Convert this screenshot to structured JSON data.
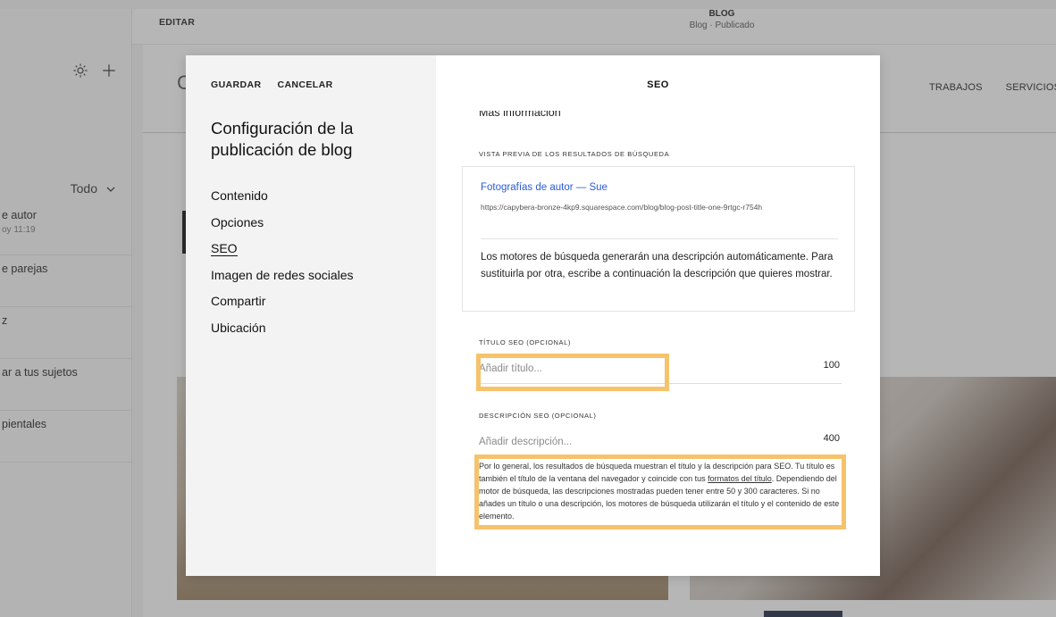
{
  "left_panel": {
    "filter_label": "Todo",
    "items": [
      {
        "title": "e autor",
        "subtitle": "oy 11:19"
      },
      {
        "title": "e parejas",
        "subtitle": ""
      },
      {
        "title": "z",
        "subtitle": ""
      },
      {
        "title": "ar a tus sujetos",
        "subtitle": ""
      },
      {
        "title": "pientales",
        "subtitle": ""
      }
    ]
  },
  "topbar": {
    "edit_label": "EDITAR",
    "page_name": "BLOG",
    "page_status": "Blog · Publicado"
  },
  "site_nav": [
    "TRABAJOS",
    "SERVICIOS"
  ],
  "modal": {
    "save_label": "GUARDAR",
    "cancel_label": "CANCELAR",
    "heading": "Configuración de la publicación de blog",
    "nav": [
      "Contenido",
      "Opciones",
      "SEO",
      "Imagen de redes sociales",
      "Compartir",
      "Ubicación"
    ],
    "active_nav": "SEO",
    "panel_title": "SEO",
    "more_info": "Más información",
    "preview": {
      "label": "VISTA PREVIA DE LOS RESULTADOS DE BÚSQUEDA",
      "title": "Fotografías de autor — Sue",
      "url": "https://capybera-bronze-4kp9.squarespace.com/blog/blog-post-title-one-9rtgc-r754h",
      "description": "Los motores de búsqueda generarán una descripción automáticamente. Para sustituirla por otra, escribe a continuación la descripción que quieres mostrar."
    },
    "seo_title": {
      "label": "TÍTULO SEO (OPCIONAL)",
      "placeholder": "Añadir título...",
      "count": "100"
    },
    "seo_description": {
      "label": "DESCRIPCIÓN SEO (OPCIONAL)",
      "placeholder": "Añadir descripción...",
      "count": "400"
    },
    "help": {
      "text_before": "Por lo general, los resultados de búsqueda muestran el título y la descripción para SEO. Tu título es también el título de la ventana del navegador y coincide con tus ",
      "link": "formatos del título",
      "text_after": ". Dependiendo del motor de búsqueda, las descripciones mostradas pueden tener entre 50 y 300 caracteres. Si no añades un título o una descripción, los motores de búsqueda utilizarán el título y el contenido de este elemento."
    }
  },
  "highlight_color": "#f6c26b"
}
